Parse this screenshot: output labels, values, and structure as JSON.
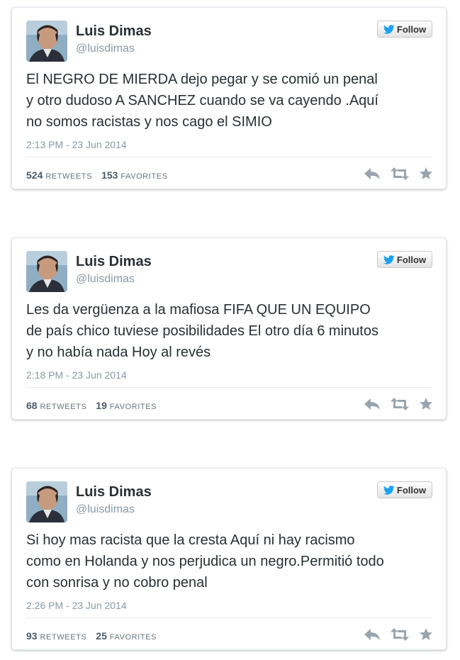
{
  "colors": {
    "icon_gray": "#99a4ae",
    "twitter_blue": "#1da1f2",
    "text": "#292f33",
    "muted": "#8899a6"
  },
  "tweets": [
    {
      "name": "Luis Dimas",
      "handle": "@luisdimas",
      "follow_label": "Follow",
      "text_lines": [
        "El NEGRO DE MIERDA dejo pegar y se comió un penal",
        "y otro dudoso A SANCHEZ  cuando se va cayendo .Aquí",
        "no somos racistas y nos cago el SIMIO"
      ],
      "timestamp": "2:13 PM - 23 Jun 2014",
      "retweets": "524",
      "retweets_label": "RETWEETS",
      "favorites": "153",
      "favorites_label": "FAVORITES",
      "icons": [
        "reply-icon",
        "retweet-icon",
        "favorite-star-icon"
      ]
    },
    {
      "name": "Luis Dimas",
      "handle": "@luisdimas",
      "follow_label": "Follow",
      "text_lines": [
        "Les da vergüenza a la mafiosa FIFA QUE UN EQUIPO",
        "de país chico tuviese posibilidades  El otro día 6 minutos",
        "y no había nada  Hoy al revés"
      ],
      "timestamp": "2:18 PM - 23 Jun 2014",
      "retweets": "68",
      "retweets_label": "RETWEETS",
      "favorites": "19",
      "favorites_label": "FAVORITES",
      "icons": [
        "reply-icon",
        "retweet-icon",
        "favorite-star-icon"
      ]
    },
    {
      "name": "Luis Dimas",
      "handle": "@luisdimas",
      "follow_label": "Follow",
      "text_lines": [
        "Si hoy mas  racista que la cresta  Aquí ni hay racismo",
        "como  en Holanda y nos perjudica un negro.Permitió todo",
        "con sonrisa y no cobro penal"
      ],
      "timestamp": "2:26 PM - 23 Jun 2014",
      "retweets": "93",
      "retweets_label": "RETWEETS",
      "favorites": "25",
      "favorites_label": "FAVORITES",
      "icons": [
        "reply-icon",
        "retweet-icon",
        "favorite-star-icon"
      ]
    }
  ]
}
